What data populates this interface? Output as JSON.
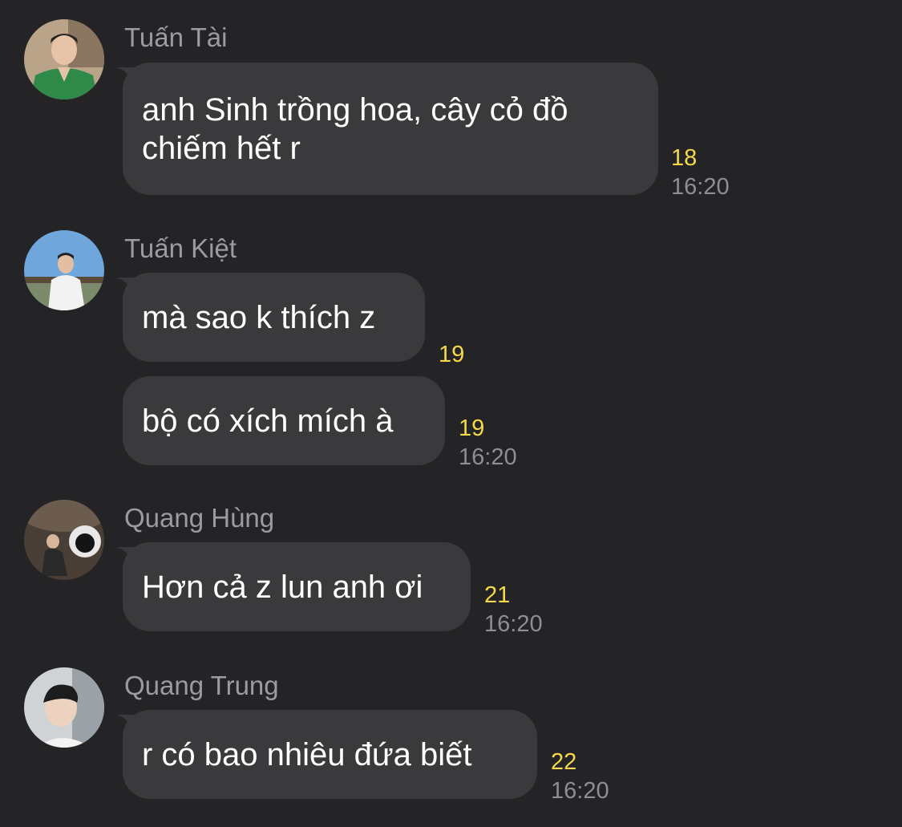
{
  "colors": {
    "background": "#242426",
    "bubble": "#3a3a3c",
    "text": "#ffffff",
    "sender": "#9b9ba0",
    "count": "#f5d94a",
    "time": "#8e8e93"
  },
  "messages": [
    {
      "sender": "Tuấn Tài",
      "avatar": "avatar-tuan-tai",
      "bubbles": [
        {
          "lines": [
            "anh Sinh trồng hoa, cây cỏ đồ",
            "chiếm hết r"
          ],
          "count": "18",
          "time": "16:20"
        }
      ]
    },
    {
      "sender": "Tuấn Kiệt",
      "avatar": "avatar-tuan-kiet",
      "bubbles": [
        {
          "lines": [
            "mà sao k thích z"
          ],
          "count": "19",
          "time": ""
        },
        {
          "lines": [
            "bộ có xích mích à"
          ],
          "count": "19",
          "time": "16:20"
        }
      ]
    },
    {
      "sender": "Quang Hùng",
      "avatar": "avatar-quang-hung",
      "bubbles": [
        {
          "lines": [
            "Hơn cả z lun anh ơi"
          ],
          "count": "21",
          "time": "16:20"
        }
      ]
    },
    {
      "sender": "Quang Trung",
      "avatar": "avatar-quang-trung",
      "bubbles": [
        {
          "lines": [
            "r có bao nhiêu đứa biết"
          ],
          "count": "22",
          "time": "16:20"
        }
      ]
    }
  ]
}
